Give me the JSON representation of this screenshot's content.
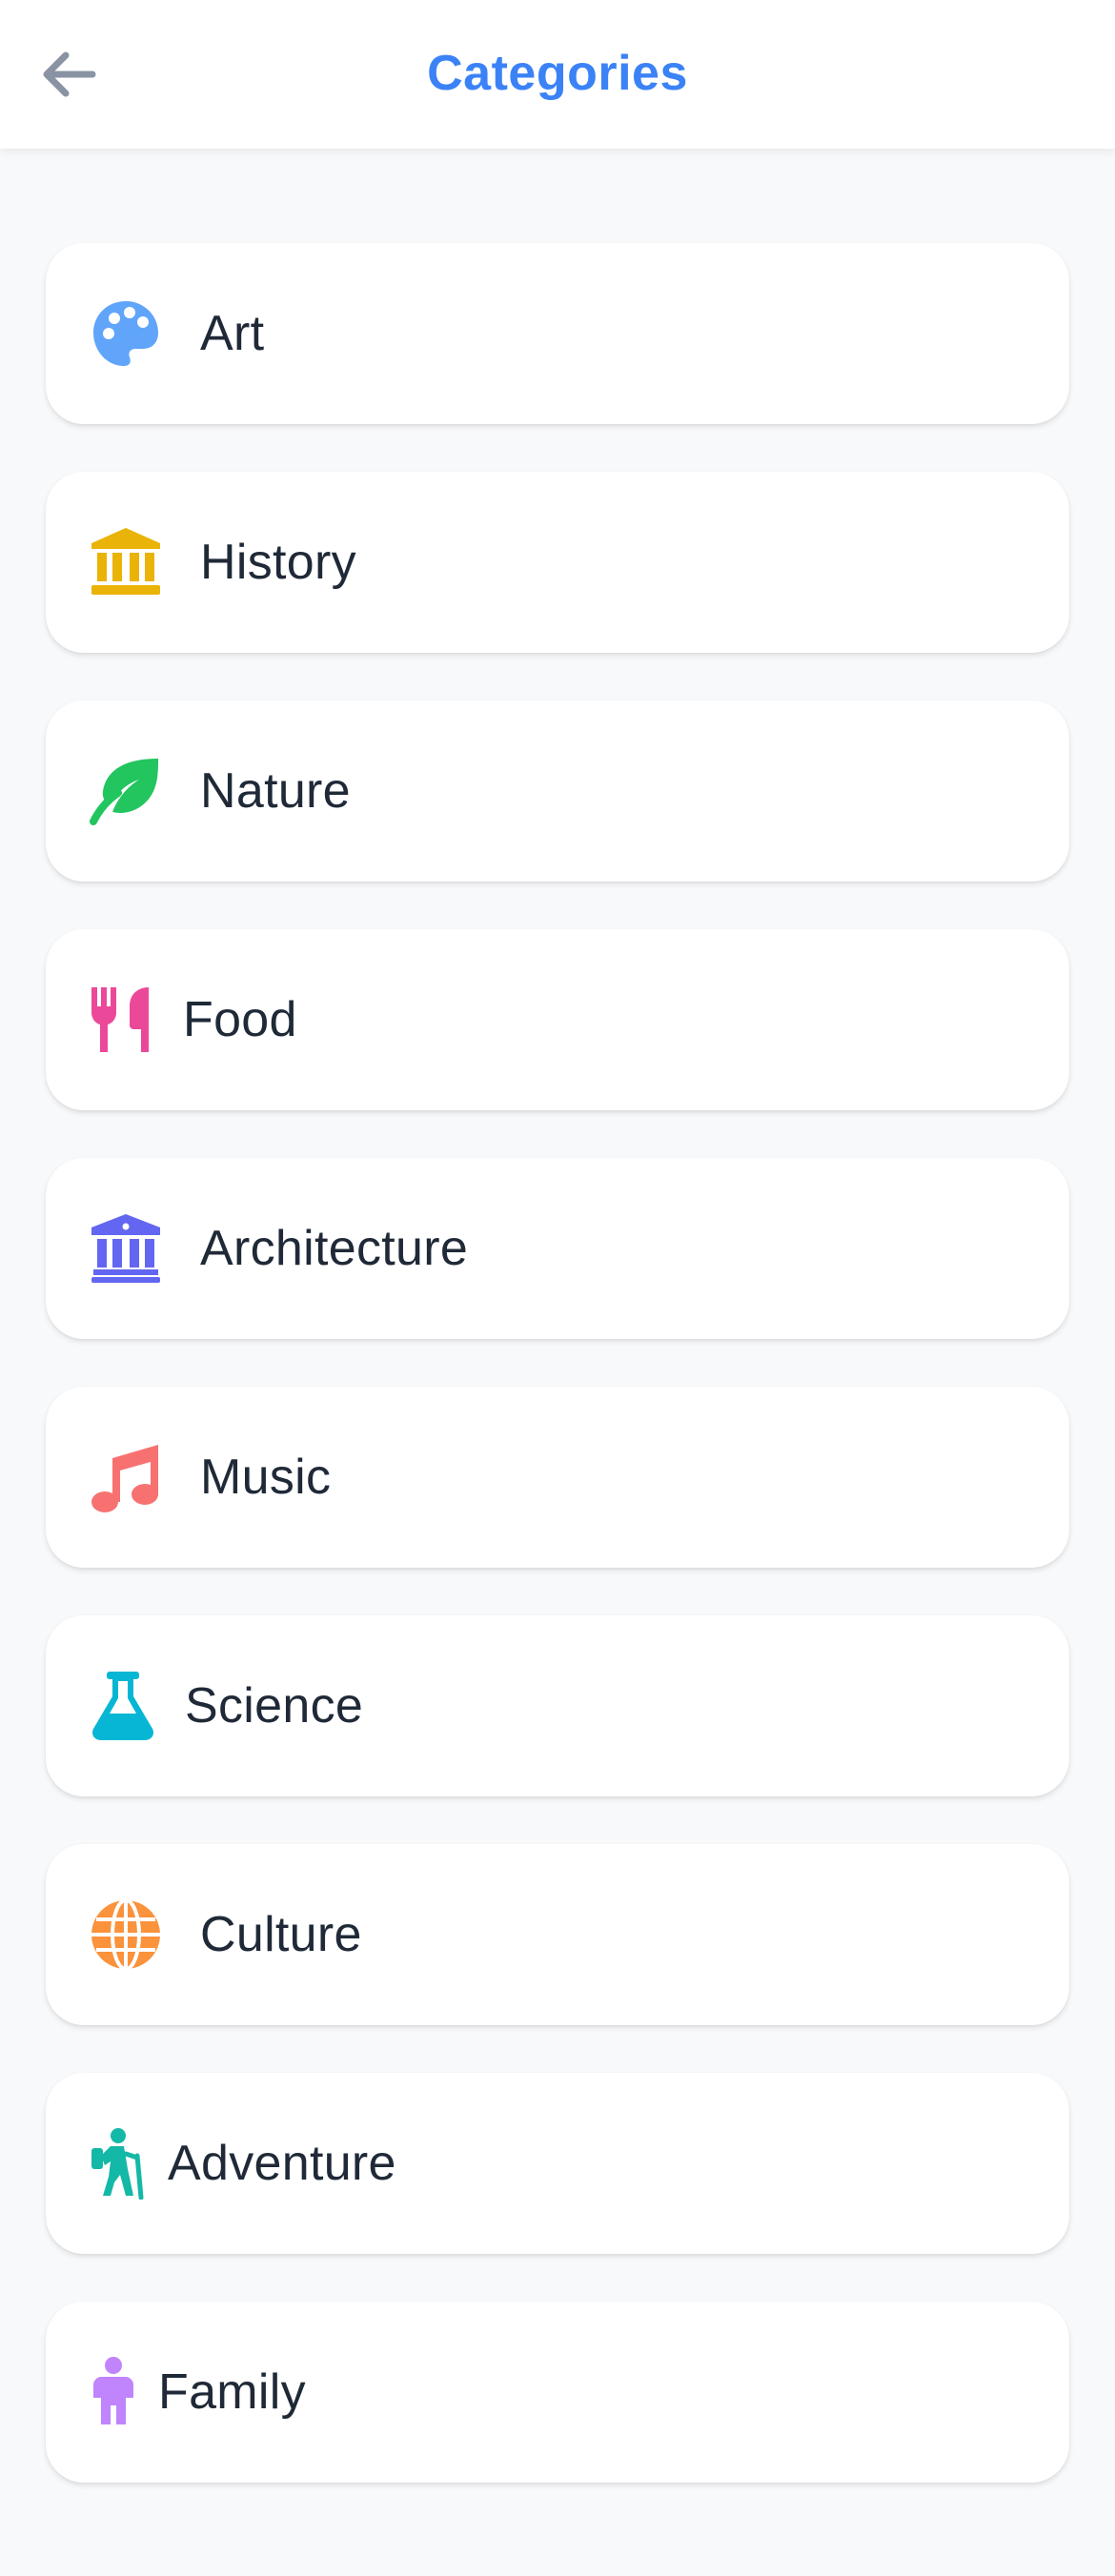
{
  "header": {
    "title": "Categories",
    "back_icon": "arrow-left-icon"
  },
  "colors": {
    "accent": "#3b82f6",
    "text": "#1f2937",
    "back": "#8a93a3",
    "art": "#60a5fa",
    "history": "#eab308",
    "nature": "#22c55e",
    "food": "#ec4899",
    "architecture": "#6366f1",
    "music": "#f87171",
    "science": "#06b6d4",
    "culture": "#fb923c",
    "adventure": "#14b8a6",
    "family": "#c084fc"
  },
  "categories": [
    {
      "label": "Art",
      "icon": "palette-icon"
    },
    {
      "label": "History",
      "icon": "landmark-icon"
    },
    {
      "label": "Nature",
      "icon": "leaf-icon"
    },
    {
      "label": "Food",
      "icon": "utensils-icon"
    },
    {
      "label": "Architecture",
      "icon": "building-columns-icon"
    },
    {
      "label": "Music",
      "icon": "music-note-icon"
    },
    {
      "label": "Science",
      "icon": "flask-icon"
    },
    {
      "label": "Culture",
      "icon": "globe-icon"
    },
    {
      "label": "Adventure",
      "icon": "hiking-icon"
    },
    {
      "label": "Family",
      "icon": "child-icon"
    }
  ]
}
